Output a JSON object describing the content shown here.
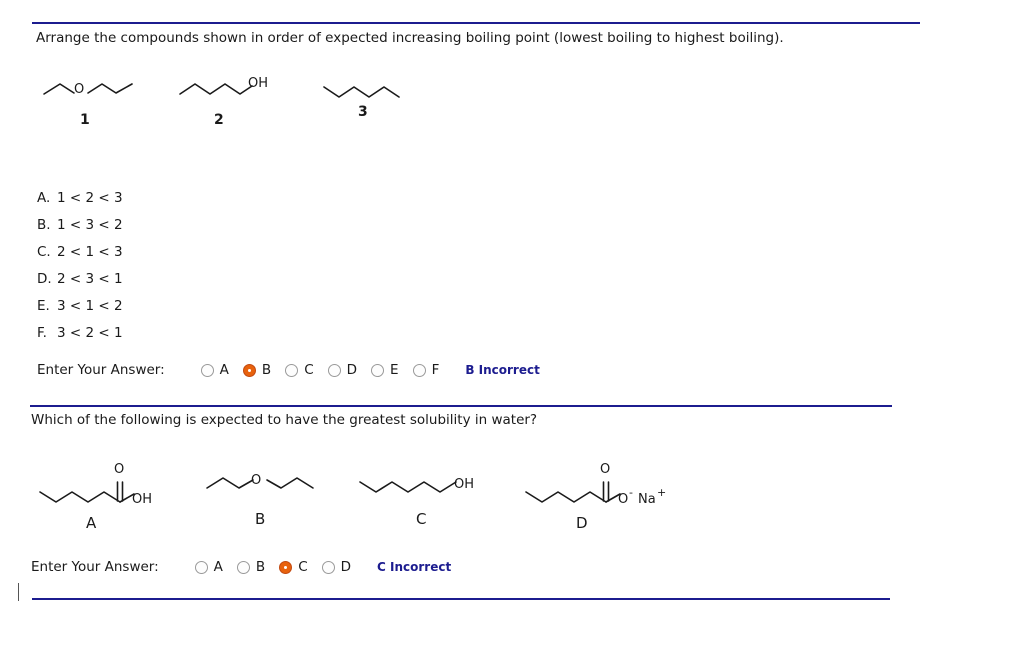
{
  "question1": {
    "text": "Arrange the compounds shown in order of expected increasing boiling point (lowest boiling to highest boiling).",
    "structures": [
      {
        "id": "1",
        "label": "1",
        "type": "ether",
        "atom_labels": [
          "O"
        ]
      },
      {
        "id": "2",
        "label": "2",
        "type": "alcohol",
        "atom_labels": [
          "OH"
        ]
      },
      {
        "id": "3",
        "label": "3",
        "type": "alkane",
        "atom_labels": []
      }
    ],
    "choices": [
      {
        "letter": "A.",
        "text": "1 < 2 < 3"
      },
      {
        "letter": "B.",
        "text": "1 < 3 < 2"
      },
      {
        "letter": "C.",
        "text": "2 < 1 < 3"
      },
      {
        "letter": "D.",
        "text": "2 < 3 < 1"
      },
      {
        "letter": "E.",
        "text": "3 < 1 < 2"
      },
      {
        "letter": "F.",
        "text": "3 < 2 < 1"
      }
    ],
    "answer": {
      "label": "Enter Your Answer:",
      "options": [
        "A",
        "B",
        "C",
        "D",
        "E",
        "F"
      ],
      "selected": "B",
      "verdict": "B Incorrect"
    }
  },
  "question2": {
    "text": "Which of the following is expected to have the greatest solubility in water?",
    "structures": [
      {
        "id": "A",
        "label": "A",
        "type": "carboxylic-acid",
        "atom_labels": [
          "O",
          "OH"
        ]
      },
      {
        "id": "B",
        "label": "B",
        "type": "ether",
        "atom_labels": [
          "O"
        ]
      },
      {
        "id": "C",
        "label": "C",
        "type": "alcohol",
        "atom_labels": [
          "OH"
        ]
      },
      {
        "id": "D",
        "label": "D",
        "type": "carboxylate-salt",
        "atom_labels": [
          "O",
          "O",
          "-",
          "Na",
          "+"
        ]
      }
    ],
    "answer": {
      "label": "Enter Your Answer:",
      "options": [
        "A",
        "B",
        "C",
        "D"
      ],
      "selected": "C",
      "verdict": "C Incorrect"
    }
  },
  "colors": {
    "rule": "#1c1c8f",
    "selected_radio": "#e8620d",
    "verdict": "#1c1c8f",
    "text": "#1a1a1a"
  }
}
